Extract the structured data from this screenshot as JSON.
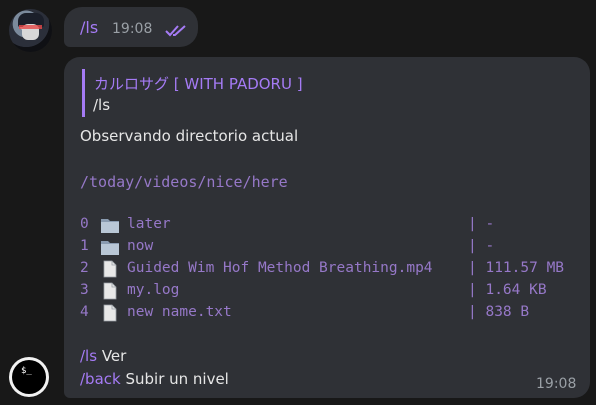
{
  "outgoing": {
    "command": "/ls",
    "time": "19:08"
  },
  "bot_message": {
    "reply_to_name": "カルロサグ [ WITH PADORU ]",
    "reply_to_text": "/ls",
    "title": "Observando directorio actual",
    "path": "/today/videos/nice/here",
    "entries": [
      {
        "index": "0",
        "type": "folder",
        "name": "later",
        "size": "| -"
      },
      {
        "index": "1",
        "type": "folder",
        "name": "now",
        "size": "| -"
      },
      {
        "index": "2",
        "type": "file",
        "name": "Guided Wim Hof Method Breathing.mp4",
        "size": "| 111.57 MB"
      },
      {
        "index": "3",
        "type": "file",
        "name": "my.log",
        "size": "| 1.64 KB"
      },
      {
        "index": "4",
        "type": "file",
        "name": "new name.txt",
        "size": "| 838 B"
      }
    ],
    "commands": [
      {
        "cmd": "/ls",
        "desc": " Ver"
      },
      {
        "cmd": "/back",
        "desc": " Subir un nivel"
      }
    ],
    "time": "19:08"
  },
  "bot_avatar": {
    "symbol": "$_"
  },
  "colors": {
    "background": "#181818",
    "bubble": "#2f3136",
    "accent": "#a57bf5",
    "mono_text": "#9678c8"
  },
  "icons": [
    "user-avatar",
    "double-check-icon",
    "folder-icon",
    "file-icon",
    "terminal-avatar"
  ]
}
